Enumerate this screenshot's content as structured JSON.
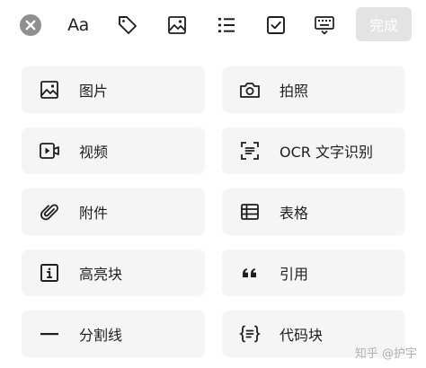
{
  "toolbar": {
    "text_style_label": "Aa",
    "done_label": "完成",
    "icons": [
      "close-icon",
      "text-style-icon",
      "tag-icon",
      "image-icon",
      "list-icon",
      "checkbox-icon",
      "keyboard-icon"
    ]
  },
  "grid": {
    "items": [
      {
        "label": "图片",
        "icon": "image-icon"
      },
      {
        "label": "拍照",
        "icon": "camera-icon"
      },
      {
        "label": "视频",
        "icon": "video-icon"
      },
      {
        "label": "OCR 文字识别",
        "icon": "ocr-scan-icon"
      },
      {
        "label": "附件",
        "icon": "paperclip-icon"
      },
      {
        "label": "表格",
        "icon": "table-icon"
      },
      {
        "label": "高亮块",
        "icon": "info-block-icon"
      },
      {
        "label": "引用",
        "icon": "quote-icon"
      },
      {
        "label": "分割线",
        "icon": "divider-icon"
      },
      {
        "label": "代码块",
        "icon": "code-block-icon"
      }
    ]
  },
  "watermark": "知乎 @护宇",
  "colors": {
    "tile_bg": "#f5f5f5",
    "done_bg": "#e3e3e3",
    "close_bg": "#8f8f8f",
    "text": "#1e1e1e"
  }
}
